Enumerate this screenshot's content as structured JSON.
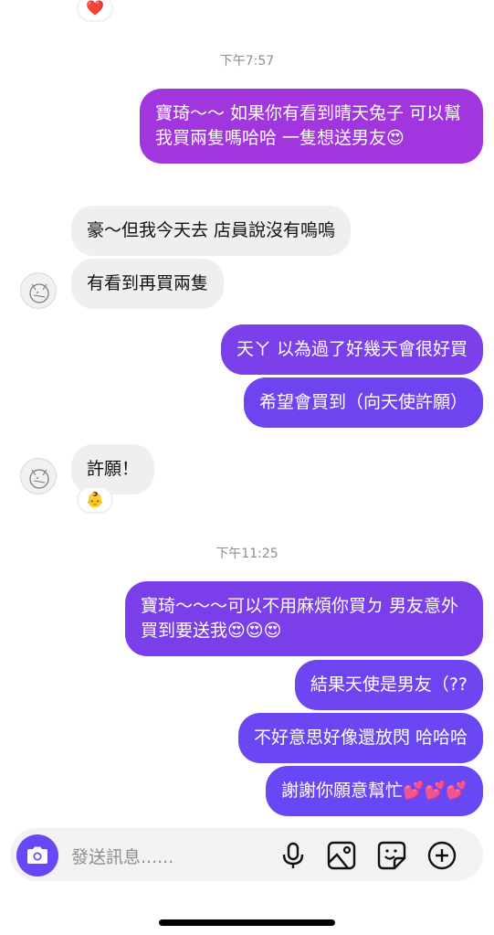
{
  "timestamps": [
    "下午7:57",
    "下午11:25"
  ],
  "messages": {
    "m1": "寶琦～～ 如果你有看到晴天兔子 可以幫我買兩隻嗎哈哈 一隻想送男友😍",
    "m2": "豪～但我今天去 店員說沒有嗚嗚",
    "m3": "有看到再買兩隻",
    "m4": "天ㄚ 以為過了好幾天會很好買",
    "m5": "希望會買到（向天使許願）",
    "m6": "許願！",
    "m7": "寶琦～～～可以不用麻煩你買ㄉ 男友意外買到要送我😍😍😍",
    "m8": "結果天使是男友（??",
    "m9": "不好意思好像還放閃 哈哈哈",
    "m10": "謝謝你願意幫忙💕💕💕"
  },
  "reactions": {
    "top": "❤️",
    "m6": "👶"
  },
  "composer": {
    "placeholder": "發送訊息......"
  },
  "icons": [
    "camera-icon",
    "microphone-icon",
    "image-icon",
    "sticker-icon",
    "plus-icon"
  ],
  "colors": {
    "accent": "#6a47f5",
    "bubble_in": "#efefef",
    "purple_top": "#a033e0",
    "purple_bottom": "#6a47f5"
  }
}
